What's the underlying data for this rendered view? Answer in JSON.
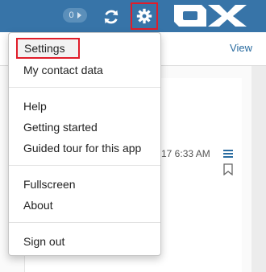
{
  "topbar": {
    "notification_count": "0",
    "refresh_icon": "refresh-icon",
    "settings_icon": "gear-icon",
    "logo_text": "OX",
    "color": "#3774a8"
  },
  "toolbar": {
    "view_label": "View"
  },
  "mail": {
    "time": "17 6:33 AM"
  },
  "menu": {
    "items": [
      {
        "label": "Settings"
      },
      {
        "label": "My contact data"
      },
      {
        "label": "Help"
      },
      {
        "label": "Getting started"
      },
      {
        "label": "Guided tour for this app"
      },
      {
        "label": "Fullscreen"
      },
      {
        "label": "About"
      },
      {
        "label": "Sign out"
      }
    ]
  },
  "highlight_color": "#e01d2a"
}
